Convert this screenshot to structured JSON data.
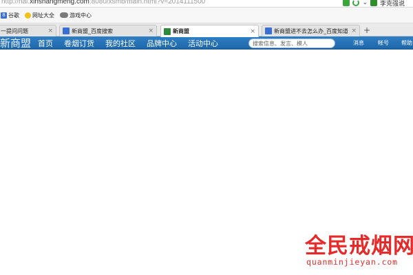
{
  "address_bar": {
    "url_prefix": "http://nai.",
    "url_host": "xinshangmeng.com",
    "url_path": ":8080/xsmb/main.html?v=2014111500",
    "user_label": "李克强说"
  },
  "bookmarks": [
    {
      "label": "谷歌",
      "icon": "google-icon"
    },
    {
      "label": "网址大全",
      "icon": "sites-icon"
    },
    {
      "label": "游戏中心",
      "icon": "game-controller-icon"
    }
  ],
  "tabs": [
    {
      "label": "一提问问题",
      "icon": "",
      "active": false
    },
    {
      "label": "新商盟_百度搜索",
      "icon": "baidu-paw-icon",
      "active": false
    },
    {
      "label": "新商盟",
      "icon": "xinshangmeng-icon",
      "active": true
    },
    {
      "label": "新商盟进不去怎么办_百度知道",
      "icon": "baidu-paw-icon",
      "active": false
    }
  ],
  "new_tab_label": "+",
  "site": {
    "logo_text": "新商盟",
    "nav": [
      "首页",
      "卷烟订货",
      "我的社区",
      "品牌中心",
      "活动中心"
    ],
    "search_placeholder": "搜索信息、发言、模人",
    "right_links": [
      "消息",
      "帐号",
      "帮助"
    ]
  },
  "watermark": {
    "title": "全民戒烟网",
    "domain": "quanminjieyan.com"
  },
  "colors": {
    "nav_blue": "#2a74bb",
    "watermark_red": "#e62a2a"
  }
}
